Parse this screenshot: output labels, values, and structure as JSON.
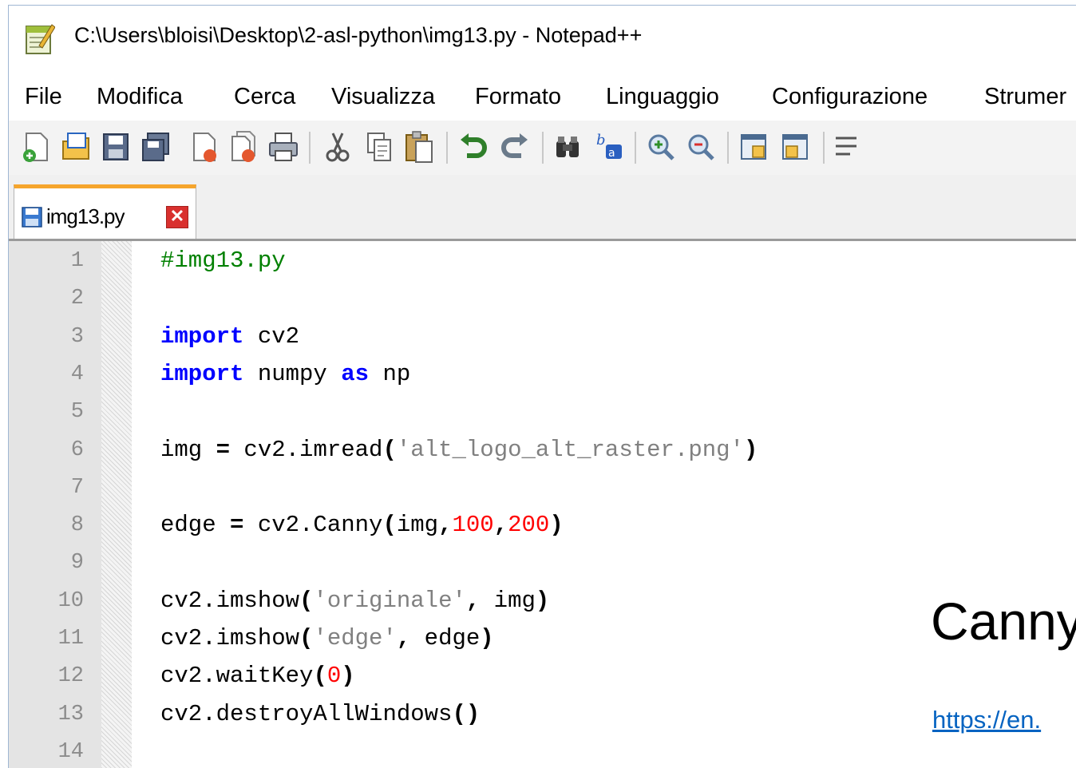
{
  "window": {
    "title": "C:\\Users\\bloisi\\Desktop\\2-asl-python\\img13.py - Notepad++"
  },
  "menu": [
    "File",
    "Modifica",
    "Cerca",
    "Visualizza",
    "Formato",
    "Linguaggio",
    "Configurazione",
    "Strumer"
  ],
  "toolbar": [
    "new-file-icon",
    "open-file-icon",
    "save-icon",
    "save-all-icon",
    "close-icon",
    "close-all-icon",
    "print-icon",
    "cut-icon",
    "copy-icon",
    "paste-icon",
    "undo-icon",
    "redo-icon",
    "find-icon",
    "replace-icon",
    "zoom-in-icon",
    "zoom-out-icon",
    "sync-vertical-icon",
    "sync-horizontal-icon",
    "word-wrap-icon"
  ],
  "tab": {
    "label": "img13.py",
    "close_glyph": "✕"
  },
  "editor": {
    "line_numbers": [
      "1",
      "2",
      "3",
      "4",
      "5",
      "6",
      "7",
      "8",
      "9",
      "10",
      "11",
      "12",
      "13",
      "14"
    ],
    "lines": [
      [
        {
          "t": "#img13.py",
          "c": "cm"
        }
      ],
      [],
      [
        {
          "t": "import",
          "c": "kw"
        },
        {
          "t": " cv2",
          "c": ""
        }
      ],
      [
        {
          "t": "import",
          "c": "kw"
        },
        {
          "t": " numpy ",
          "c": ""
        },
        {
          "t": "as",
          "c": "kw"
        },
        {
          "t": " np",
          "c": ""
        }
      ],
      [],
      [
        {
          "t": "img ",
          "c": ""
        },
        {
          "t": "=",
          "c": "op"
        },
        {
          "t": " cv2.imread",
          "c": ""
        },
        {
          "t": "(",
          "c": "op"
        },
        {
          "t": "'alt_logo_alt_raster.png'",
          "c": "st"
        },
        {
          "t": ")",
          "c": "op"
        }
      ],
      [],
      [
        {
          "t": "edge ",
          "c": ""
        },
        {
          "t": "=",
          "c": "op"
        },
        {
          "t": " cv2.Canny",
          "c": ""
        },
        {
          "t": "(",
          "c": "op"
        },
        {
          "t": "img",
          "c": ""
        },
        {
          "t": ",",
          "c": "op"
        },
        {
          "t": "100",
          "c": "nu"
        },
        {
          "t": ",",
          "c": "op"
        },
        {
          "t": "200",
          "c": "nu"
        },
        {
          "t": ")",
          "c": "op"
        }
      ],
      [],
      [
        {
          "t": "cv2.imshow",
          "c": ""
        },
        {
          "t": "(",
          "c": "op"
        },
        {
          "t": "'originale'",
          "c": "st"
        },
        {
          "t": ",",
          "c": "op"
        },
        {
          "t": " img",
          "c": ""
        },
        {
          "t": ")",
          "c": "op"
        }
      ],
      [
        {
          "t": "cv2.imshow",
          "c": ""
        },
        {
          "t": "(",
          "c": "op"
        },
        {
          "t": "'edge'",
          "c": "st"
        },
        {
          "t": ",",
          "c": "op"
        },
        {
          "t": " edge",
          "c": ""
        },
        {
          "t": ")",
          "c": "op"
        }
      ],
      [
        {
          "t": "cv2.waitKey",
          "c": ""
        },
        {
          "t": "(",
          "c": "op"
        },
        {
          "t": "0",
          "c": "nu"
        },
        {
          "t": ")",
          "c": "op"
        }
      ],
      [
        {
          "t": "cv2.destroyAllWindows",
          "c": ""
        },
        {
          "t": "()",
          "c": "op"
        }
      ],
      []
    ]
  },
  "slide": {
    "heading": "Canny",
    "link": "https://en."
  },
  "colors": {
    "keyword": "#0000ff",
    "string": "#808080",
    "number": "#ff0000",
    "comment": "#008000",
    "tab_accent": "#f6a52c",
    "link": "#0563c1"
  }
}
